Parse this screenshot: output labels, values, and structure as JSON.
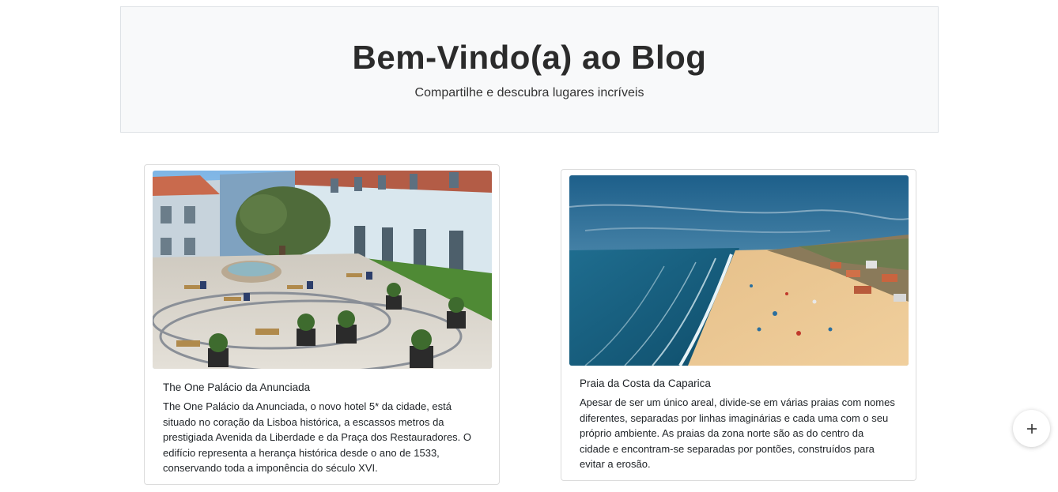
{
  "header": {
    "title": "Bem-Vindo(a) ao Blog",
    "subtitle": "Compartilhe e descubra lugares incríveis"
  },
  "posts": [
    {
      "title": "The One Palácio da Anunciada",
      "text": "The One Palácio da Anunciada, o novo hotel 5* da cidade, está situado no coração da Lisboa histórica, a escassos metros da prestigiada Avenida da Liberdade e da Praça dos Restauradores. O edifício representa a herança histórica desde o ano de 1533, conservando toda a imponência do século XVI."
    },
    {
      "title": "Praia da Costa da Caparica",
      "text": "Apesar de ser um único areal, divide-se em várias praias com nomes diferentes, separadas por linhas imaginárias e cada uma com o seu próprio ambiente. As praias da zona norte são as do centro da cidade e encontram-se separadas por pontões, construídos para evitar a erosão."
    }
  ],
  "fab": {
    "icon": "plus-icon"
  },
  "colors": {
    "hero_bg": "#f8f9fa",
    "border": "#dee2e6",
    "text": "#212529"
  }
}
